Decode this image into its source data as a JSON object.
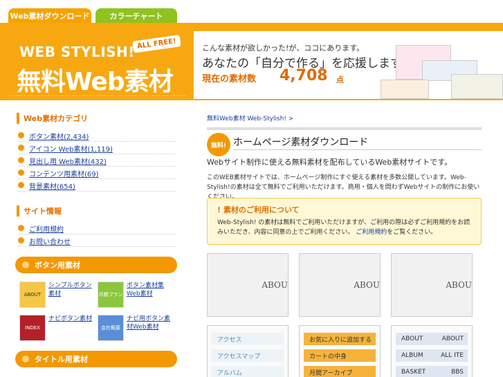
{
  "tabs": [
    "Web素材ダウンロード",
    "カラーチャート"
  ],
  "logo": {
    "line1": "WEB STYLISH!",
    "badge": "ALL FREE!",
    "line2": "無料Web素材"
  },
  "banner": {
    "l1": "こんな素材が欲しかった!が、ココにあります。",
    "l2": "あなたの「自分で作る」を応援します。",
    "l3": "現在の素材数",
    "count": "4,708",
    "unit": "点"
  },
  "sidebar": {
    "sec1": "Web素材カテゴリ",
    "cats": [
      "ボタン素材(2,434)",
      "アイコン Web素材(1,119)",
      "見出し用 Web素材(432)",
      "コンテンツ用素材(69)",
      "背景素材(654)"
    ],
    "sec2": "サイト情報",
    "info": [
      "ご利用規約",
      "お問い合わせ"
    ],
    "pill1": "ボタン用素材",
    "buttons": [
      {
        "thumb": "ABOUT",
        "text": "シンプルボタン素材"
      },
      {
        "thumb": "月額プラン",
        "text": "ボタン素材集Web素材"
      },
      {
        "thumb": "INDEX",
        "text": "ナビボタン素材"
      },
      {
        "thumb": "会社概要",
        "text": "ナビ用ボタン素材Web素材"
      }
    ],
    "pill2": "タイトル用素材"
  },
  "main": {
    "breadcrumb": "無料Web素材 Web-Stylish! >",
    "badge": "無料!",
    "title": "ホームページ素材ダウンロード",
    "intro": "Webサイト制作に使える無料素材を配布しているWeb素材サイトです。",
    "desc": "このWEB素材サイトでは、ホームページ制作にすぐ使える素材を多数公開しています。Web-Stylish!の素材は全て無料でご利用いただけます。商用・個人を問わずWebサイトの制作にお使いください。",
    "notice_title": "素材のご利用について",
    "notice_text": "Web-Stylish! の素材は無料でご利用いただけますが、ご利用の際は必ずご利用規約をお読みいただき、内容に同意の上でご利用ください。",
    "notice_link": "ご利用規約",
    "notice_tail": "をご覧ください。",
    "samples": [
      "ABOU",
      "ABOU",
      "ABOU"
    ],
    "nav1": [
      "アクセス",
      "アクセスマップ",
      "アルバム"
    ],
    "nav2": [
      "お気に入りに追加する",
      "カートの中身",
      "月間アーカイブ"
    ],
    "nav3": [
      "ABOUT",
      "ALBUM",
      "BASKET"
    ],
    "nav3b": [
      "ABOUT",
      "ALL ITE",
      "BBS"
    ]
  }
}
